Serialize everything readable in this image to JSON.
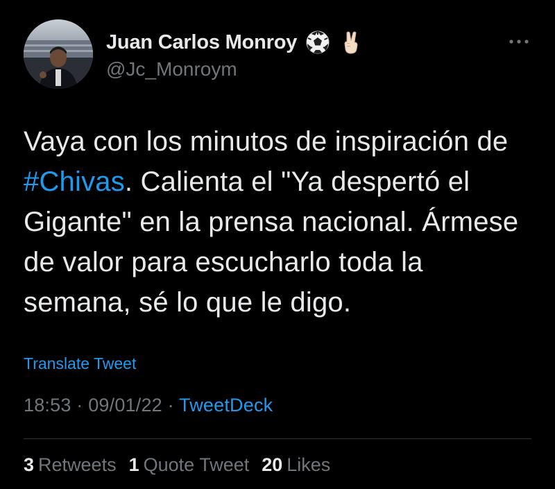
{
  "user": {
    "display_name": "Juan Carlos Monroy",
    "handle": "@Jc_Monroym",
    "emojis": [
      "soccer-ball-icon",
      "victory-hand-icon"
    ]
  },
  "tweet": {
    "text_before_hashtag": "Vaya con los minutos de inspiración de ",
    "hashtag": "#Chivas",
    "text_after_hashtag": ". Calienta el \"Ya despertó el Gigante\" en la prensa nacional. Ármese de valor para escucharlo toda la semana, sé lo que le digo."
  },
  "translate_label": "Translate Tweet",
  "meta": {
    "time": "18:53",
    "date": "09/01/22",
    "separator": "·",
    "source": "TweetDeck"
  },
  "stats": [
    {
      "count": "3",
      "label": "Retweets"
    },
    {
      "count": "1",
      "label": "Quote Tweet"
    },
    {
      "count": "20",
      "label": "Likes"
    }
  ],
  "colors": {
    "background": "#000000",
    "text": "#e7e9ea",
    "secondary": "#71767b",
    "accent": "#1d9bf0",
    "divider": "#2f3336"
  }
}
